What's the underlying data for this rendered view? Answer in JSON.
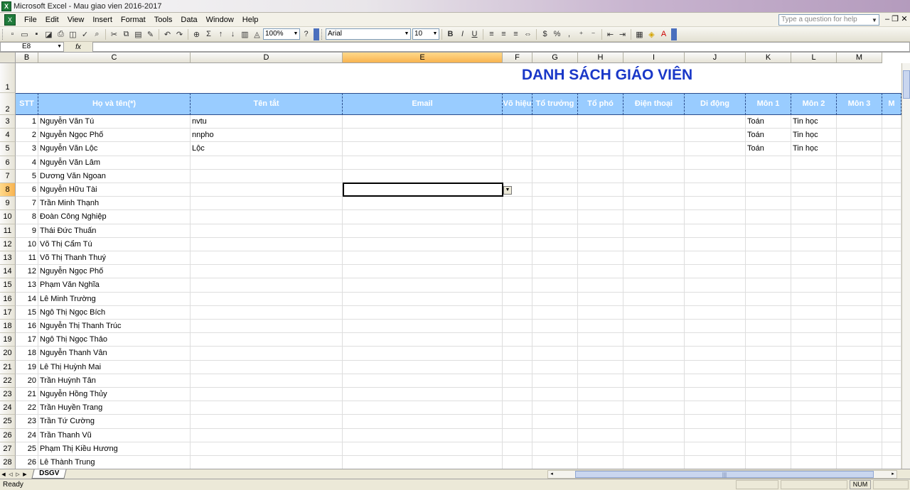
{
  "window": {
    "title": "Microsoft Excel - Mau giao vien 2016-2017"
  },
  "menu": [
    "File",
    "Edit",
    "View",
    "Insert",
    "Format",
    "Tools",
    "Data",
    "Window",
    "Help"
  ],
  "help_placeholder": "Type a question for help",
  "toolbar": {
    "zoom": "100%",
    "font": "Arial",
    "size": "10"
  },
  "formula": {
    "name_box": "E8",
    "fx": "fx"
  },
  "columns": [
    "B",
    "C",
    "D",
    "E",
    "F",
    "G",
    "H",
    "I",
    "J",
    "K",
    "L",
    "M"
  ],
  "sheet": {
    "title": "DANH SÁCH GIÁO VIÊN",
    "headers": [
      "STT",
      "Họ và tên(*)",
      "Tên tắt",
      "Email",
      "Võ hiệu",
      "Tổ trưởng",
      "Tổ phó",
      "Điện thoại",
      "Di động",
      "Môn 1",
      "Môn 2",
      "Môn 3",
      "M"
    ],
    "row_numbers": [
      "1",
      "2",
      "3",
      "4",
      "5",
      "6",
      "7",
      "8",
      "9",
      "10",
      "11",
      "12",
      "13",
      "14",
      "15",
      "16",
      "17",
      "18",
      "19",
      "20",
      "21",
      "22",
      "23",
      "24",
      "25",
      "26",
      "27",
      "28"
    ],
    "rows": [
      {
        "stt": "1",
        "name": "Nguyễn Văn Tú",
        "short": "nvtu",
        "mon1": "Toán",
        "mon2": "Tin học"
      },
      {
        "stt": "2",
        "name": "Nguyễn Ngọc Phố",
        "short": "nnpho",
        "mon1": "Toán",
        "mon2": "Tin học"
      },
      {
        "stt": "3",
        "name": "Nguyễn Văn Lộc",
        "short": "Lộc",
        "mon1": "Toán",
        "mon2": "Tin học"
      },
      {
        "stt": "4",
        "name": "Nguyễn Văn Lâm"
      },
      {
        "stt": "5",
        "name": "Dương Văn Ngoan"
      },
      {
        "stt": "6",
        "name": "Nguyễn Hữu Tài"
      },
      {
        "stt": "7",
        "name": "Trần Minh Thạnh"
      },
      {
        "stt": "8",
        "name": "Đoàn Công Nghiệp"
      },
      {
        "stt": "9",
        "name": "Thái Đức Thuấn"
      },
      {
        "stt": "10",
        "name": "Võ Thị Cẩm Tú"
      },
      {
        "stt": "11",
        "name": "Võ Thị Thanh Thuý"
      },
      {
        "stt": "12",
        "name": "Nguyễn Ngọc Phố"
      },
      {
        "stt": "13",
        "name": "Phạm Văn Nghĩa"
      },
      {
        "stt": "14",
        "name": "Lê Minh Trường"
      },
      {
        "stt": "15",
        "name": "Ngô Thị Ngọc Bích"
      },
      {
        "stt": "16",
        "name": "Nguyễn Thị Thanh Trúc"
      },
      {
        "stt": "17",
        "name": "Ngô Thị Ngọc Thảo"
      },
      {
        "stt": "18",
        "name": "Nguyễn Thanh Vân"
      },
      {
        "stt": "19",
        "name": "Lê Thị Huỳnh Mai"
      },
      {
        "stt": "20",
        "name": "Trần Huỳnh Tân"
      },
      {
        "stt": "21",
        "name": "Nguyễn Hồng Thủy"
      },
      {
        "stt": "22",
        "name": "Trần Huyền Trang"
      },
      {
        "stt": "23",
        "name": "Trần Tứ Cường"
      },
      {
        "stt": "24",
        "name": "Trần Thanh Vũ"
      },
      {
        "stt": "25",
        "name": "Phạm Thị Kiều Hương"
      },
      {
        "stt": "26",
        "name": "Lê Thành Trung"
      }
    ]
  },
  "sheet_tab": "DSGV",
  "status": {
    "left": "Ready",
    "num": "NUM"
  },
  "colors": {
    "header_fill": "#99ccff",
    "title_color": "#1a38c8",
    "active_header": "#f8b350"
  }
}
